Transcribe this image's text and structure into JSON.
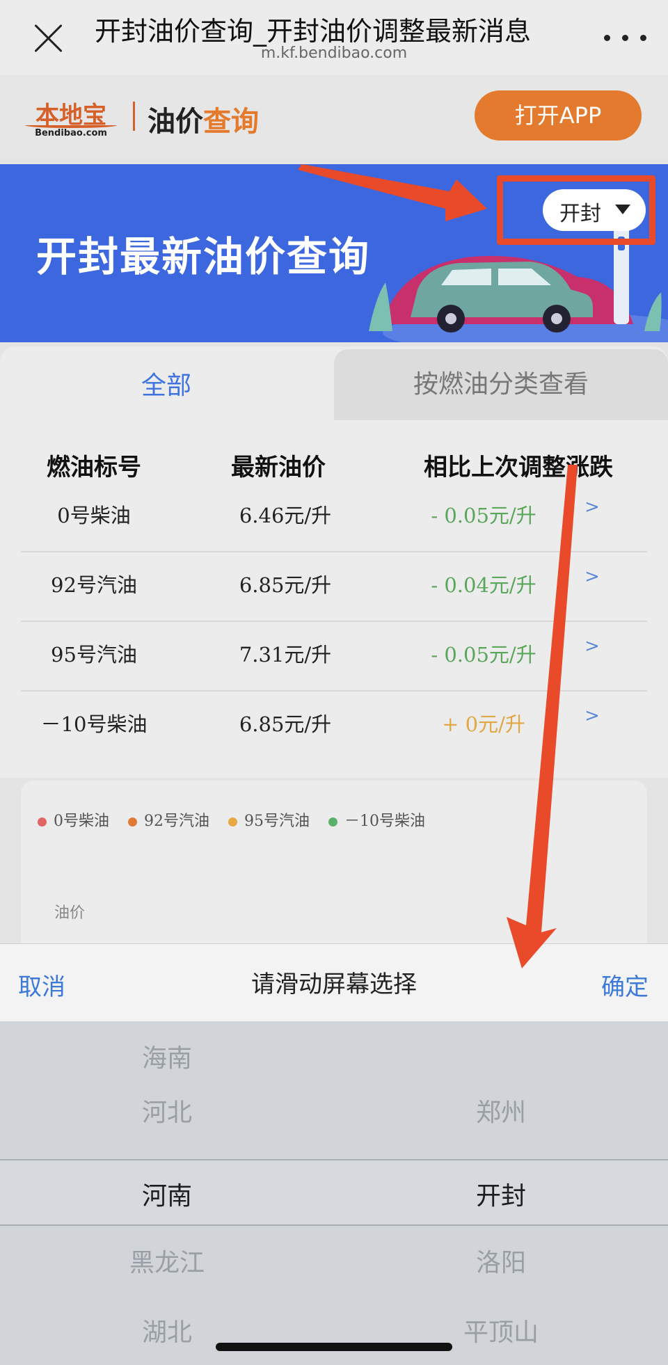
{
  "browser": {
    "title": "开封油价查询_开封油价调整最新消息",
    "url": "m.kf.bendibao.com"
  },
  "header": {
    "logo_cn": "本地宝",
    "logo_en": "Bendibao.com",
    "title_part1": "油价",
    "title_part2": "查询",
    "open_app": "打开APP",
    "accent_color": "#e47a2e"
  },
  "banner": {
    "title": "开封最新油价查询",
    "city": "开封",
    "bg_color": "#3d67de"
  },
  "tabs": {
    "all": "全部",
    "by_category": "按燃油分类查看"
  },
  "table": {
    "headers": [
      "燃油标号",
      "最新油价",
      "相比上次调整涨跌"
    ],
    "rows": [
      {
        "fuel": "0号柴油",
        "price": "6.46元/升",
        "change": "- 0.05元/升",
        "dir": "down"
      },
      {
        "fuel": "92号汽油",
        "price": "6.85元/升",
        "change": "- 0.04元/升",
        "dir": "down"
      },
      {
        "fuel": "95号汽油",
        "price": "7.31元/升",
        "change": "- 0.05元/升",
        "dir": "down"
      },
      {
        "fuel": "－10号柴油",
        "price": "6.85元/升",
        "change": "+ 0元/升",
        "dir": "up"
      }
    ],
    "chevron": ">",
    "down_color": "#5aa65a",
    "up_color": "#e0a845"
  },
  "chart": {
    "legend": [
      {
        "label": "0号柴油",
        "color": "#e06666"
      },
      {
        "label": "92号汽油",
        "color": "#e07a35"
      },
      {
        "label": "95号汽油",
        "color": "#e6a944"
      },
      {
        "label": "－10号柴油",
        "color": "#5bb06a"
      }
    ],
    "ylabel": "油价"
  },
  "picker": {
    "cancel": "取消",
    "title": "请滑动屏幕选择",
    "confirm": "确定",
    "provinces": [
      "海南",
      "河北",
      "河南",
      "黑龙江",
      "湖北"
    ],
    "selected_province": "河南",
    "cities": [
      "",
      "郑州",
      "开封",
      "洛阳",
      "平顶山"
    ],
    "selected_city": "开封"
  }
}
